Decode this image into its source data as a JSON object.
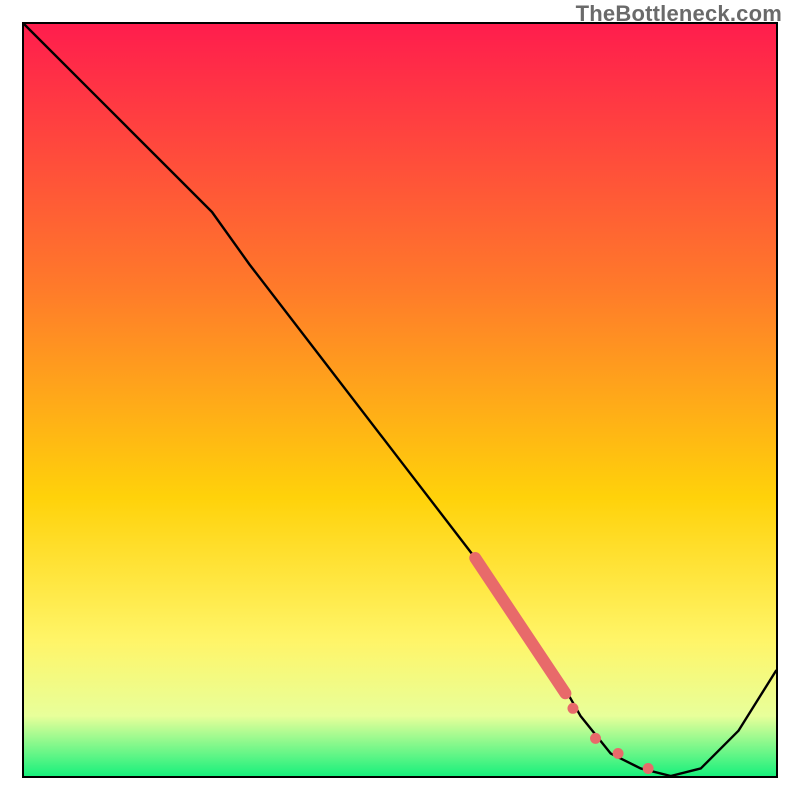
{
  "watermark": "TheBottleneck.com",
  "colors": {
    "gradient_top": "#ff1d4d",
    "gradient_mid1": "#ff7a2a",
    "gradient_mid2": "#ffd20a",
    "gradient_mid3": "#fff568",
    "gradient_band": "#e8ff9a",
    "gradient_bottom": "#18f07c",
    "curve": "#000000",
    "marker": "#e86a6a"
  },
  "chart_data": {
    "type": "line",
    "title": "",
    "xlabel": "",
    "ylabel": "",
    "xlim": [
      0,
      100
    ],
    "ylim": [
      0,
      100
    ],
    "grid": false,
    "legend": false,
    "series": [
      {
        "name": "bottleneck-curve",
        "x": [
          0,
          10,
          20,
          25,
          30,
          40,
          50,
          60,
          65,
          70,
          74,
          78,
          82,
          86,
          90,
          95,
          100
        ],
        "y": [
          100,
          90,
          80,
          75,
          68,
          55,
          42,
          29,
          22,
          15,
          8,
          3,
          1,
          0,
          1,
          6,
          14
        ]
      }
    ],
    "markers": [
      {
        "name": "highlight-segment",
        "shape": "thick-line",
        "x": [
          60,
          72
        ],
        "y": [
          29,
          11
        ]
      },
      {
        "name": "dot-1",
        "shape": "circle",
        "x": 73,
        "y": 9
      },
      {
        "name": "dot-2",
        "shape": "circle",
        "x": 76,
        "y": 5
      },
      {
        "name": "dot-3",
        "shape": "circle",
        "x": 79,
        "y": 3
      },
      {
        "name": "dot-4",
        "shape": "circle",
        "x": 83,
        "y": 1
      }
    ]
  }
}
